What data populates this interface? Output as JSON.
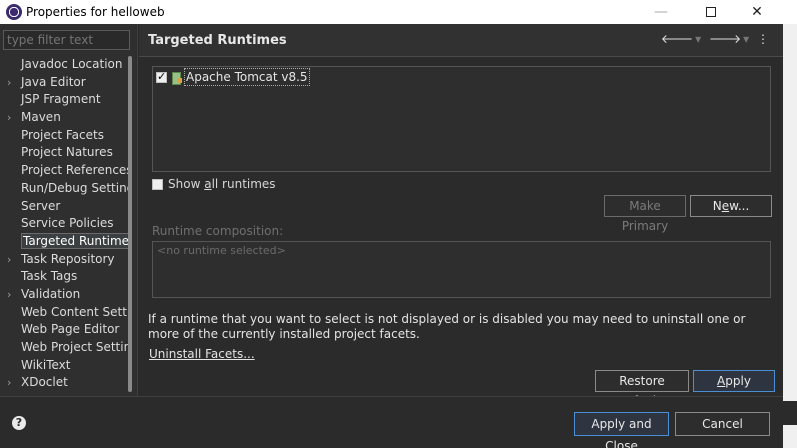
{
  "window": {
    "title": "Properties for helloweb",
    "minimize_glyph": "—",
    "close_glyph": "✕"
  },
  "sidebar": {
    "filter_placeholder": "type filter text",
    "items": [
      {
        "label": "Javadoc Location",
        "expandable": false
      },
      {
        "label": "Java Editor",
        "expandable": true
      },
      {
        "label": "JSP Fragment",
        "expandable": false
      },
      {
        "label": "Maven",
        "expandable": true
      },
      {
        "label": "Project Facets",
        "expandable": false
      },
      {
        "label": "Project Natures",
        "expandable": false
      },
      {
        "label": "Project References",
        "expandable": false
      },
      {
        "label": "Run/Debug Settings",
        "expandable": false
      },
      {
        "label": "Server",
        "expandable": false
      },
      {
        "label": "Service Policies",
        "expandable": false
      },
      {
        "label": "Targeted Runtimes",
        "expandable": false,
        "selected": true
      },
      {
        "label": "Task Repository",
        "expandable": true
      },
      {
        "label": "Task Tags",
        "expandable": false
      },
      {
        "label": "Validation",
        "expandable": true
      },
      {
        "label": "Web Content Settings",
        "expandable": false
      },
      {
        "label": "Web Page Editor",
        "expandable": false
      },
      {
        "label": "Web Project Settings",
        "expandable": false
      },
      {
        "label": "WikiText",
        "expandable": false
      },
      {
        "label": "XDoclet",
        "expandable": true
      }
    ]
  },
  "main": {
    "title": "Targeted Runtimes",
    "runtimes": [
      {
        "label": "Apache Tomcat v8.5",
        "checked": true
      }
    ],
    "show_all": {
      "prefix": "Show ",
      "mnemonic": "a",
      "suffix": "ll runtimes",
      "checked": false
    },
    "make_primary_label": "Make Primary",
    "new_label": {
      "prefix": "N",
      "mnemonic": "e",
      "suffix": "w..."
    },
    "composition_label": "Runtime composition:",
    "composition_placeholder": "<no runtime selected>",
    "note": "If a runtime that you want to select is not displayed or is disabled you may need to uninstall one or more of the currently installed project facets.",
    "uninstall_link": "Uninstall Facets...",
    "restore_label": {
      "prefix": "Restore ",
      "mnemonic": "D",
      "suffix": "efaults"
    },
    "apply_label": {
      "prefix": "",
      "mnemonic": "A",
      "suffix": "pply"
    }
  },
  "footer": {
    "apply_close_label": "Apply and Close",
    "cancel_label": "Cancel"
  },
  "colors": {
    "background": "#2b2b2b",
    "accent_border": "#4a8fd6",
    "text": "#e4e4e4"
  }
}
